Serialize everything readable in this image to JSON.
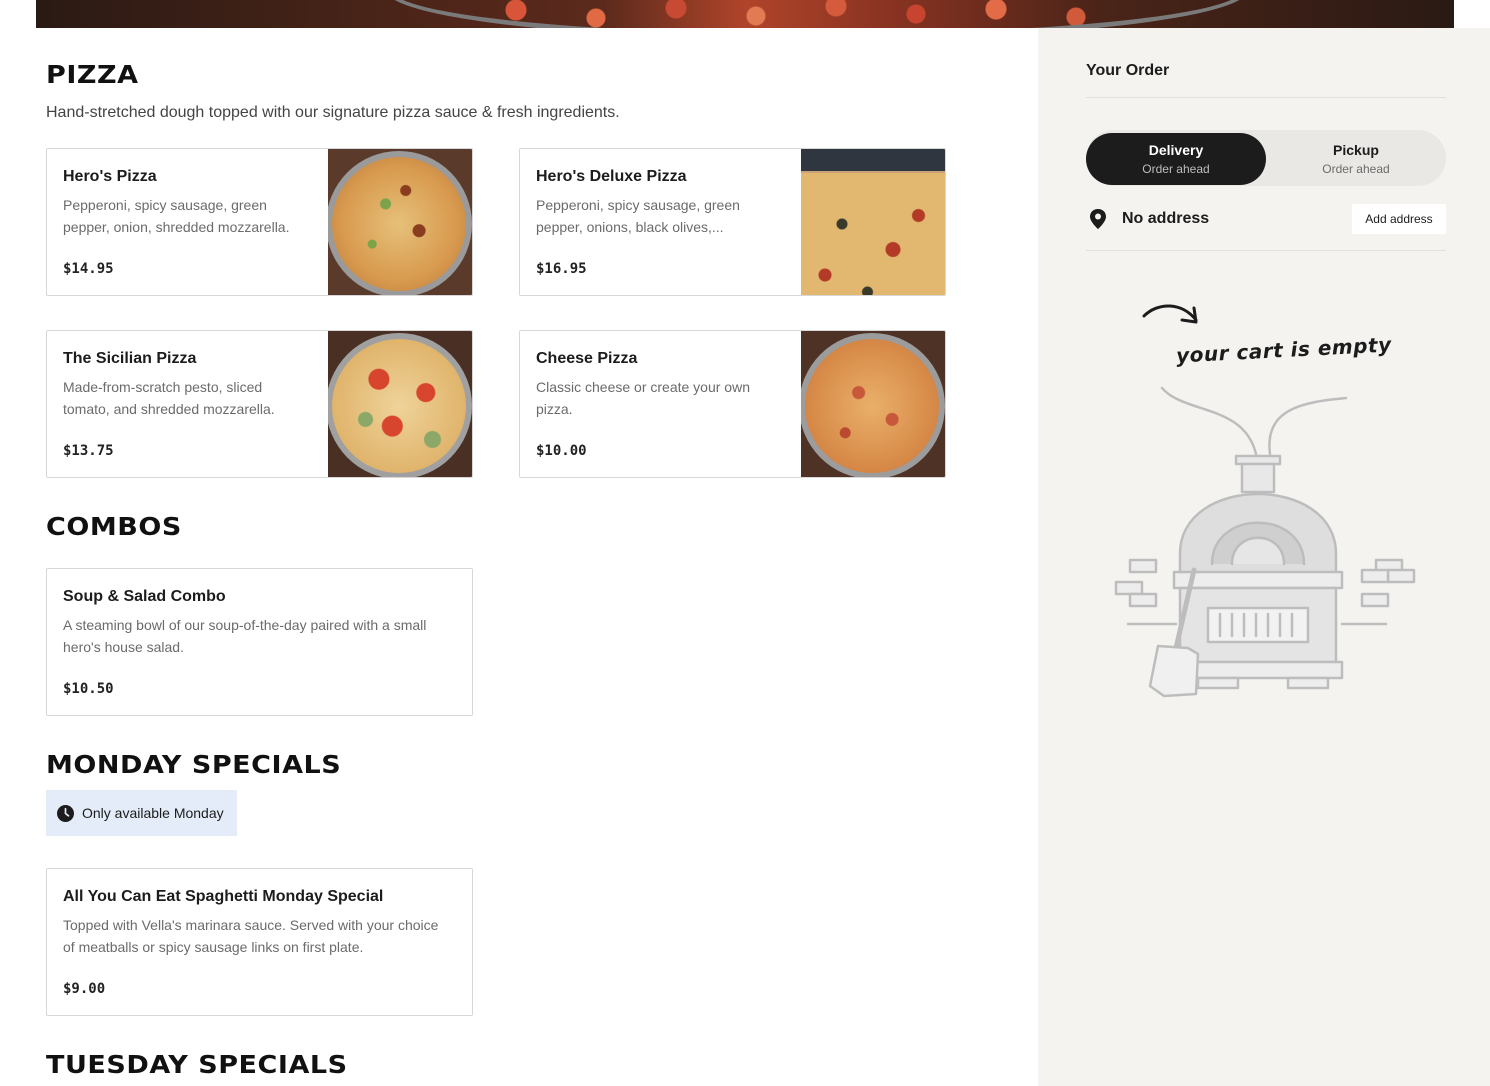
{
  "sections": {
    "pizza": {
      "title": "PIZZA",
      "description": "Hand-stretched dough topped with our signature pizza sauce & fresh ingredients.",
      "items": [
        {
          "name": "Hero's Pizza",
          "desc": "Pepperoni, spicy sausage, green pepper, onion, shredded mozzarella.",
          "price": "$14.95"
        },
        {
          "name": "Hero's Deluxe Pizza",
          "desc": "Pepperoni, spicy sausage, green pepper, onions, black olives,...",
          "price": "$16.95"
        },
        {
          "name": "The Sicilian Pizza",
          "desc": "Made-from-scratch pesto, sliced tomato, and shredded mozzarella.",
          "price": "$13.75"
        },
        {
          "name": "Cheese Pizza",
          "desc": "Classic cheese or create your own pizza.",
          "price": "$10.00"
        }
      ]
    },
    "combos": {
      "title": "COMBOS",
      "items": [
        {
          "name": "Soup & Salad Combo",
          "desc": "A steaming bowl of our soup-of-the-day paired with a small hero's house salad.",
          "price": "$10.50"
        }
      ]
    },
    "monday": {
      "title": "MONDAY SPECIALS",
      "badge": "Only available Monday",
      "items": [
        {
          "name": "All You Can Eat Spaghetti Monday Special",
          "desc": "Topped with Vella's marinara sauce. Served with your choice of meatballs or spicy sausage links on first plate.",
          "price": "$9.00"
        }
      ]
    },
    "tuesday": {
      "title": "TUESDAY SPECIALS"
    }
  },
  "order": {
    "title": "Your Order",
    "delivery_label": "Delivery",
    "delivery_sub": "Order ahead",
    "pickup_label": "Pickup",
    "pickup_sub": "Order ahead",
    "address_label": "No address",
    "add_address_button": "Add address",
    "empty_text": "your cart is empty"
  },
  "icons": {
    "location": "location-pin-icon",
    "clock": "clock-icon",
    "arrow": "curved-arrow-icon",
    "oven": "pizza-oven-illustration"
  },
  "colors": {
    "sidebar_bg": "#f4f3f0",
    "toggle_active": "#1c1c1c",
    "badge_bg": "#e3ecf8",
    "card_border": "#d7d7d7"
  }
}
